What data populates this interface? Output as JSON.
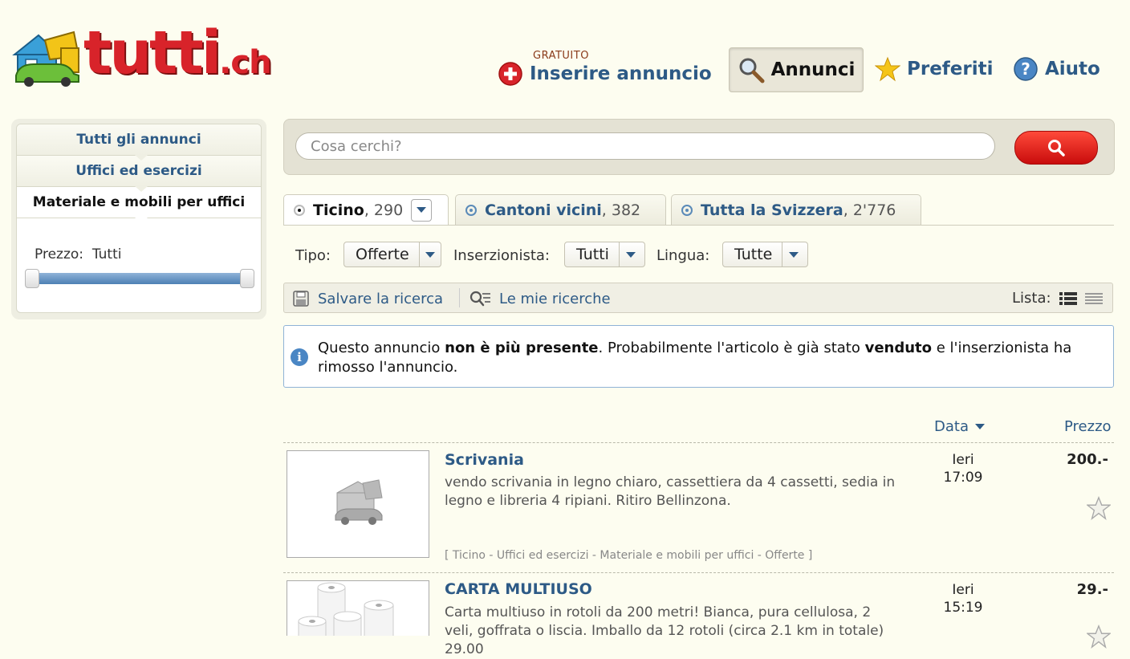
{
  "header": {
    "logo": {
      "name": "tutti",
      "ext": ".ch"
    },
    "nav": {
      "insert_sub": "GRATUITO",
      "insert_label": "Inserire annuncio",
      "annunci_label": "Annunci",
      "preferiti_label": "Preferiti",
      "aiuto_label": "Aiuto"
    }
  },
  "sidebar": {
    "items": [
      {
        "label": "Tutti gli annunci"
      },
      {
        "label": "Uffici ed esercizi"
      },
      {
        "label": "Materiale e mobili per uffici"
      }
    ],
    "price_label": "Prezzo:",
    "price_value": "Tutti"
  },
  "search": {
    "placeholder": "Cosa cerchi?",
    "value": ""
  },
  "tabs": [
    {
      "name": "Ticino",
      "count": ", 290"
    },
    {
      "name": "Cantoni vicini",
      "count": ", 382"
    },
    {
      "name": "Tutta la Svizzera",
      "count": ", 2'776"
    }
  ],
  "filters": {
    "tipo": {
      "label": "Tipo:",
      "value": "Offerte"
    },
    "inserzionista": {
      "label": "Inserzionista:",
      "value": "Tutti"
    },
    "lingua": {
      "label": "Lingua:",
      "value": "Tutte"
    }
  },
  "toolbar": {
    "save_label": "Salvare la ricerca",
    "my_searches_label": "Le mie ricerche",
    "lista_label": "Lista:"
  },
  "notice": {
    "p1": "Questo annuncio ",
    "b1": "non è più presente",
    "p2": ". Probabilmente l'articolo è già stato ",
    "b2": "venduto",
    "p3": " e l'inserzionista ha rimosso l'annuncio."
  },
  "list_header": {
    "data_label": "Data",
    "price_label": "Prezzo"
  },
  "ads": [
    {
      "title": "Scrivania",
      "description": "vendo scrivania in legno chiaro, cassettiera da 4 cassetti, sedia in legno e libreria 4 ripiani. Ritiro Bellinzona.",
      "meta": "[ Ticino - Uffici ed esercizi - Materiale e mobili per uffici - Offerte ]",
      "day": "Ieri",
      "time": "17:09",
      "price": "200.-"
    },
    {
      "title": "CARTA MULTIUSO",
      "description": "Carta multiuso in rotoli da 200 metri! Bianca, pura cellulosa, 2 veli, goffrata o liscia. Imballo da 12 rotoli (circa 2.1 km in totale) 29.00",
      "day": "Ieri",
      "time": "15:19",
      "price": "29.-"
    }
  ],
  "colors": {
    "brand_red": "#d8232a",
    "link_blue": "#2d5a86",
    "background": "#fdfdf0"
  }
}
